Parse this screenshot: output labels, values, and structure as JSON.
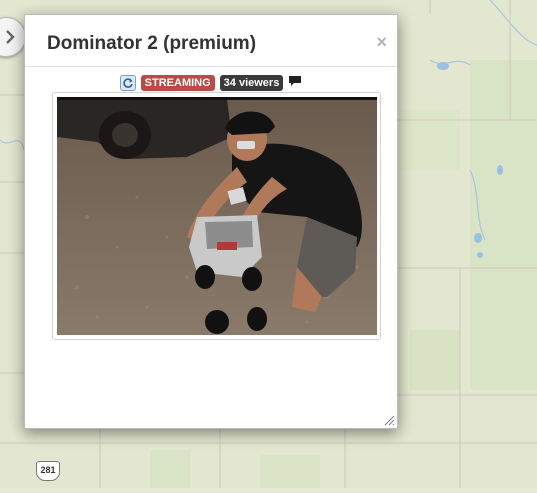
{
  "panel": {
    "title": "Dominator 2 (premium)",
    "close_label": "×"
  },
  "status": {
    "streaming_label": "STREAMING",
    "viewers_label": "34 viewers",
    "streaming_color": "#b94a48",
    "viewers_color": "#3a3a3a"
  },
  "map": {
    "route_shield_label": "281"
  },
  "icons": {
    "nav": "chevron-right-icon",
    "refresh": "refresh-icon",
    "chat": "chat-bubble-icon",
    "resize": "resize-handle-icon"
  }
}
